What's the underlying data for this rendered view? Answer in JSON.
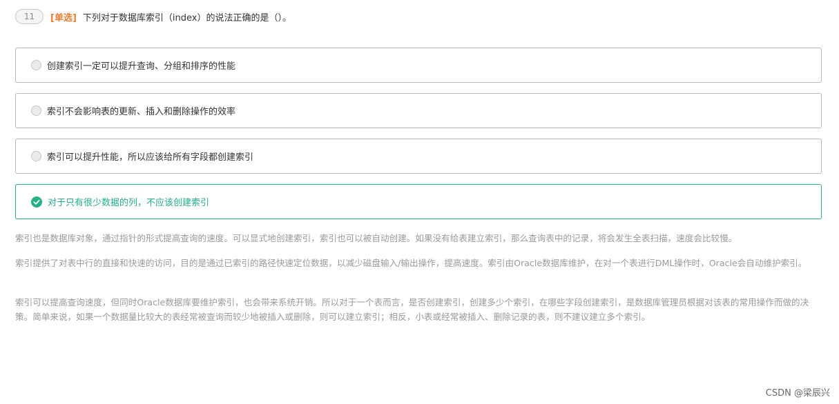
{
  "question": {
    "number": "11",
    "type": "[单选]",
    "text": "下列对于数据库索引（index）的说法正确的是（）。"
  },
  "options": [
    {
      "label": "创建索引一定可以提升查询、分组和排序的性能",
      "state": "unselected"
    },
    {
      "label": "索引不会影响表的更新、插入和删除操作的效率",
      "state": "unselected"
    },
    {
      "label": "索引可以提升性能，所以应该给所有字段都创建索引",
      "state": "unselected"
    },
    {
      "label": "对于只有很少数据的列，不应该创建索引",
      "state": "correct"
    }
  ],
  "analysis": [
    "索引也是数据库对象，通过指针的形式提高查询的速度。可以显式地创建索引，索引也可以被自动创建。如果没有给表建立索引，那么查询表中的记录，将会发生全表扫描，速度会比较慢。",
    "索引提供了对表中行的直接和快速的访问，目的是通过已索引的路径快速定位数据，以减少磁盘输入/输出操作，提高速度。索引由Oracle数据库维护，在对一个表进行DML操作时，Oracle会自动维护索引。",
    "索引可以提高查询速度，但同时Oracle数据库要维护索引，也会带来系统开销。所以对于一个表而言，是否创建索引，创建多少个索引，在哪些字段创建索引，是数据库管理员根据对该表的常用操作而做的决策。简单来说，如果一个数据量比较大的表经常被查询而较少地被插入或删除，则可以建立索引；相反，小表或经常被插入、删除记录的表，则不建议建立多个索引。"
  ],
  "watermark": "CSDN @梁辰兴",
  "colors": {
    "accent_correct": "#21b08a",
    "question_type": "#f07b2a",
    "analysis_text": "#9a9a9a",
    "option_border": "#b8b8b8"
  },
  "icons": {
    "unselected": "radio-circle-icon",
    "correct": "check-circle-icon"
  }
}
